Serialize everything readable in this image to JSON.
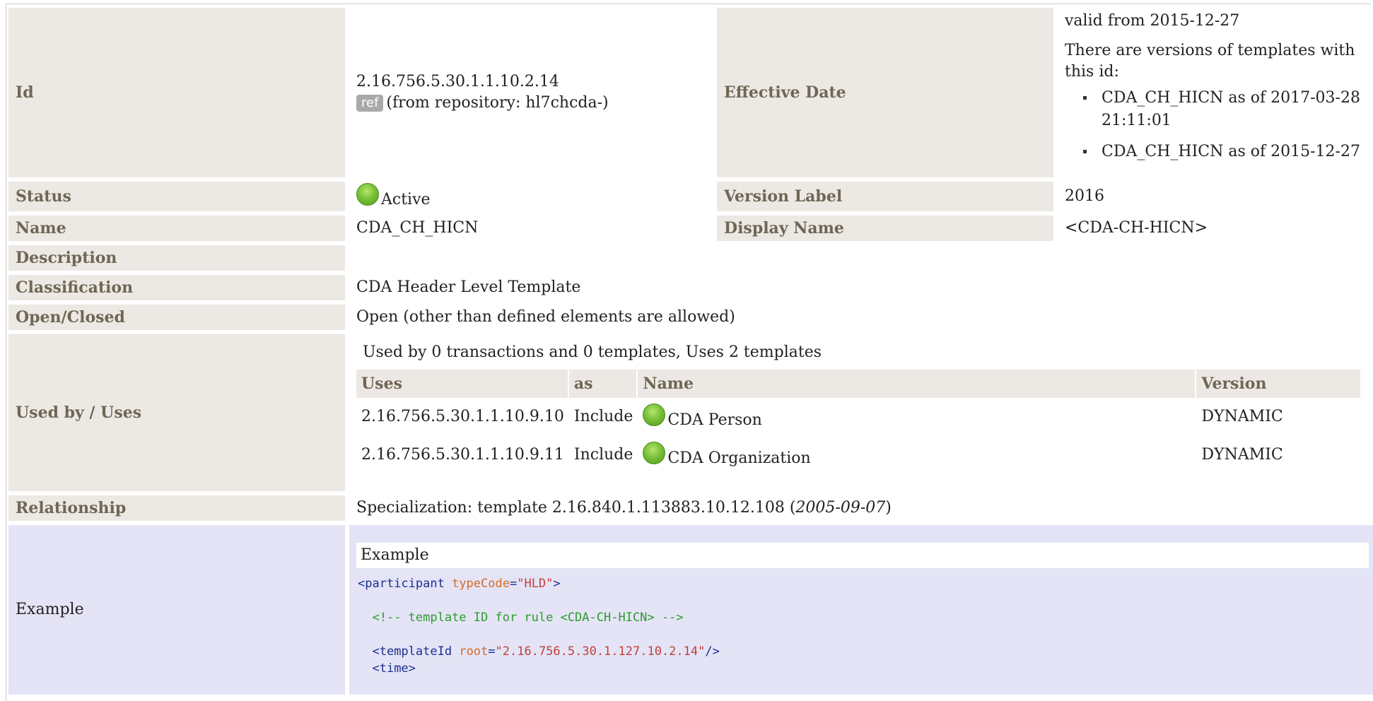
{
  "rows": {
    "id": {
      "label": "Id",
      "value": "2.16.756.5.30.1.1.10.2.14",
      "ref_badge": "ref",
      "repository_text": "(from repository: hl7chcda-)"
    },
    "effective_date": {
      "label": "Effective Date",
      "valid_from": "valid from 2015-12-27",
      "versions_intro": "There are versions of templates with this id:",
      "versions": [
        "CDA_CH_HICN as of 2017-03-28 21:11:01",
        "CDA_CH_HICN as of 2015-12-27"
      ]
    },
    "status": {
      "label": "Status",
      "value": "Active",
      "color": "#7ac13a"
    },
    "version_label": {
      "label": "Version Label",
      "value": "2016"
    },
    "name": {
      "label": "Name",
      "value": "CDA_CH_HICN"
    },
    "display_name": {
      "label": "Display Name",
      "value": "<CDA-CH-HICN>"
    },
    "description": {
      "label": "Description",
      "value": ""
    },
    "classification": {
      "label": "Classification",
      "value": "CDA Header Level Template"
    },
    "open_closed": {
      "label": "Open/Closed",
      "value": "Open (other than defined elements are allowed)"
    },
    "used_by": {
      "label": "Used by / Uses",
      "summary": "Used by 0 transactions and 0 templates, Uses 2 templates",
      "headers": {
        "uses": "Uses",
        "as": "as",
        "name": "Name",
        "version": "Version"
      },
      "items": [
        {
          "id": "2.16.756.5.30.1.1.10.9.10",
          "as": "Include",
          "name": "CDA Person",
          "version": "DYNAMIC"
        },
        {
          "id": "2.16.756.5.30.1.1.10.9.11",
          "as": "Include",
          "name": "CDA Organization",
          "version": "DYNAMIC"
        }
      ]
    },
    "relationship": {
      "label": "Relationship",
      "prefix": "Specialization: template 2.16.840.1.113883.10.12.108 (",
      "date": "2005-09-07",
      "suffix": ")"
    },
    "example": {
      "label": "Example",
      "caption": "Example",
      "code": {
        "l1_open": "<participant",
        "l1_attr": "typeCode",
        "l1_eq": "=",
        "l1_val": "\"HLD\"",
        "l1_close": ">",
        "l2_comment": "<!-- template ID for rule <CDA-CH-HICN> -->",
        "l3_open": "<templateId",
        "l3_attr": "root",
        "l3_eq": "=",
        "l3_val": "\"2.16.756.5.30.1.127.10.2.14\"",
        "l3_close": "/>",
        "l4": "<time>"
      }
    }
  },
  "colors": {
    "label_bg": "#ece8e3",
    "label_text": "#6f6656",
    "example_bg": "#e4e4f6"
  }
}
